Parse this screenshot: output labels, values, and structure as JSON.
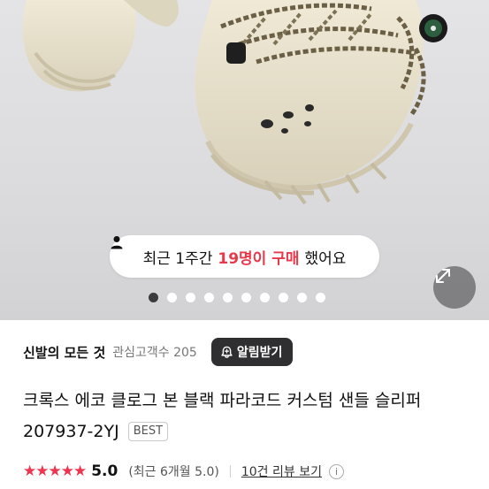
{
  "toast": {
    "prefix": "최근 1주간",
    "highlight": "19명이 구매",
    "suffix": "했어요"
  },
  "gallery": {
    "dot_count": 10,
    "active_index": 0
  },
  "store": {
    "name": "신발의 모든 것",
    "followers": "관심고객수 205",
    "alarm_label": "알림받기"
  },
  "product": {
    "title": "크록스 에코 클로그 본 블랙 파라코드 커스텀 샌들 슬리퍼 207937-2YJ",
    "badge": "BEST"
  },
  "rating": {
    "stars": "★★★★★",
    "score": "5.0",
    "recent": "(최근 6개월 5.0)",
    "reviews_link": "10건 리뷰 보기",
    "info": "i"
  },
  "colors": {
    "accent": "#e8394a",
    "button_dark": "#2f2f31",
    "star": "#f0334f",
    "shoe": "#e7e1cd"
  },
  "icons": {
    "person": "person-icon",
    "bell": "bell-icon",
    "expand": "expand-icon",
    "info": "info-icon"
  }
}
